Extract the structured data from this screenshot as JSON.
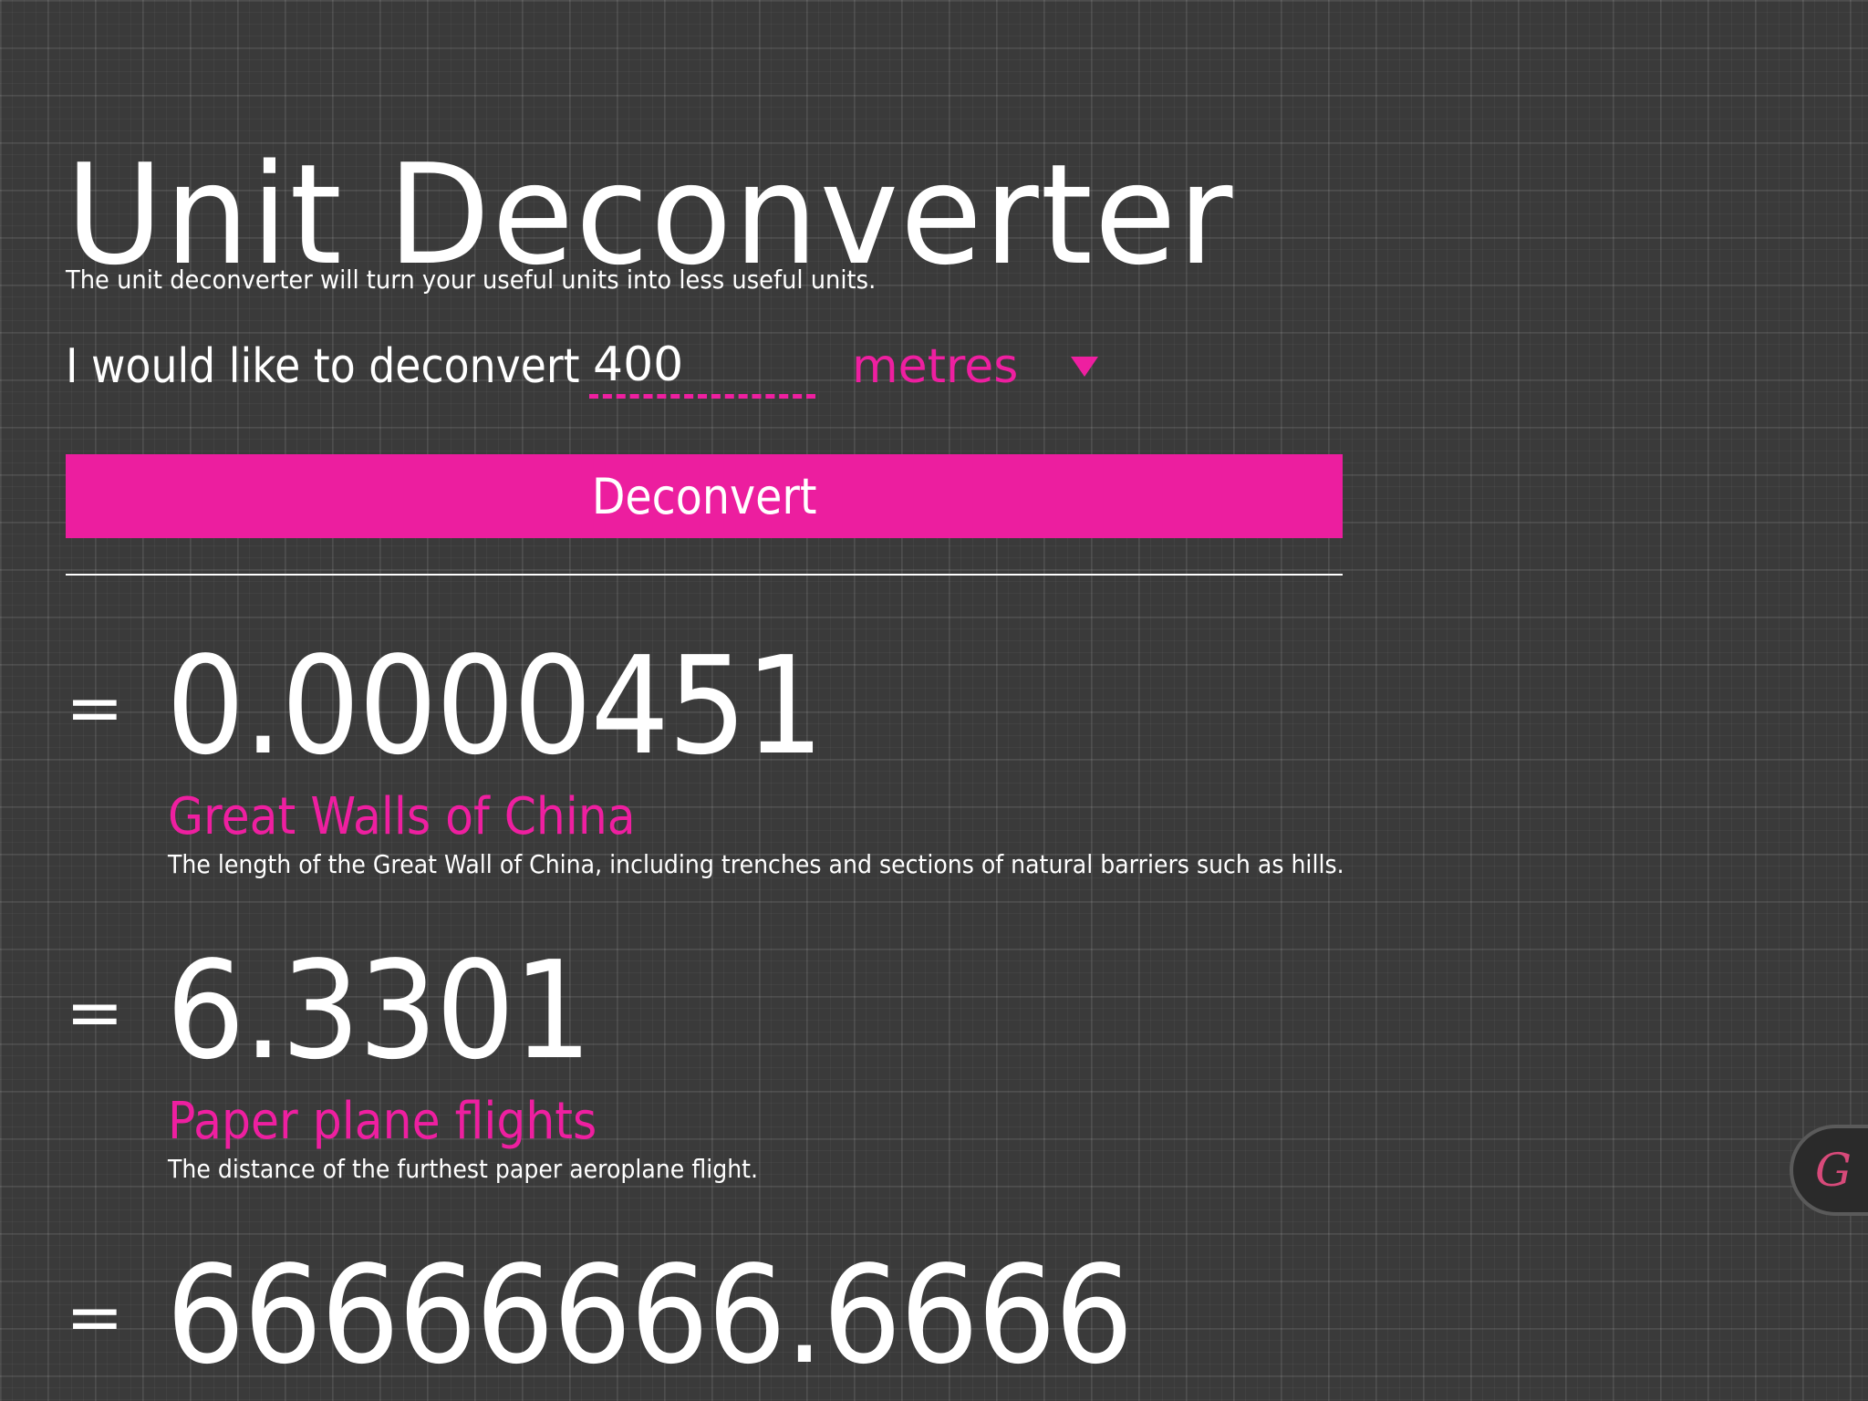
{
  "app": {
    "title": "Unit Deconverter",
    "intro": "The unit deconverter will turn your useful units into less useful units."
  },
  "form": {
    "prompt": "I would like to deconvert",
    "quantity_value": "400",
    "unit_selected": "metres",
    "button_label": "Deconvert"
  },
  "results": [
    {
      "equals": "=",
      "value": "0.0000451",
      "unit": "Great Walls of China",
      "description": "The length of the Great Wall of China, including trenches and sections of natural barriers such as hills."
    },
    {
      "equals": "=",
      "value": "6.3301",
      "unit": "Paper plane flights",
      "description": "The distance of the furthest paper aeroplane flight."
    },
    {
      "equals": "=",
      "value": "66666666.6666",
      "unit": "",
      "description": ""
    }
  ],
  "badge": {
    "glyph": "G",
    "icon": "g-logo-icon"
  },
  "colors": {
    "accent": "#ec1e9f",
    "background": "#3a3a3a",
    "text": "#ffffff"
  }
}
